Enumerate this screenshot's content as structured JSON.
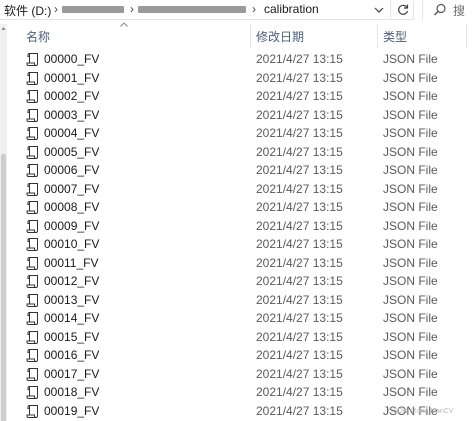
{
  "address_bar": {
    "drive_label": "软件 (D:)",
    "current_folder": "calibration"
  },
  "search": {
    "placeholder": "搜"
  },
  "columns": {
    "name": "名称",
    "modified": "修改日期",
    "type": "类型"
  },
  "files": [
    {
      "name": "00000_FV",
      "modified": "2021/4/27 13:15",
      "type": "JSON File"
    },
    {
      "name": "00001_FV",
      "modified": "2021/4/27 13:15",
      "type": "JSON File"
    },
    {
      "name": "00002_FV",
      "modified": "2021/4/27 13:15",
      "type": "JSON File"
    },
    {
      "name": "00003_FV",
      "modified": "2021/4/27 13:15",
      "type": "JSON File"
    },
    {
      "name": "00004_FV",
      "modified": "2021/4/27 13:15",
      "type": "JSON File"
    },
    {
      "name": "00005_FV",
      "modified": "2021/4/27 13:15",
      "type": "JSON File"
    },
    {
      "name": "00006_FV",
      "modified": "2021/4/27 13:15",
      "type": "JSON File"
    },
    {
      "name": "00007_FV",
      "modified": "2021/4/27 13:15",
      "type": "JSON File"
    },
    {
      "name": "00008_FV",
      "modified": "2021/4/27 13:15",
      "type": "JSON File"
    },
    {
      "name": "00009_FV",
      "modified": "2021/4/27 13:15",
      "type": "JSON File"
    },
    {
      "name": "00010_FV",
      "modified": "2021/4/27 13:15",
      "type": "JSON File"
    },
    {
      "name": "00011_FV",
      "modified": "2021/4/27 13:15",
      "type": "JSON File"
    },
    {
      "name": "00012_FV",
      "modified": "2021/4/27 13:15",
      "type": "JSON File"
    },
    {
      "name": "00013_FV",
      "modified": "2021/4/27 13:15",
      "type": "JSON File"
    },
    {
      "name": "00014_FV",
      "modified": "2021/4/27 13:15",
      "type": "JSON File"
    },
    {
      "name": "00015_FV",
      "modified": "2021/4/27 13:15",
      "type": "JSON File"
    },
    {
      "name": "00016_FV",
      "modified": "2021/4/27 13:15",
      "type": "JSON File"
    },
    {
      "name": "00017_FV",
      "modified": "2021/4/27 13:15",
      "type": "JSON File"
    },
    {
      "name": "00018_FV",
      "modified": "2021/4/27 13:15",
      "type": "JSON File"
    },
    {
      "name": "00019_FV",
      "modified": "2021/4/27 13:15",
      "type": "JSON File"
    }
  ],
  "icons": {
    "file": "json-file-icon",
    "refresh": "refresh-icon",
    "search": "search-icon",
    "dropdown": "chevron-down-icon",
    "breadcrumb_separator": "chevron-right-icon",
    "sort": "sort-up-icon"
  },
  "watermark": "CSDN @anaJuanCV"
}
